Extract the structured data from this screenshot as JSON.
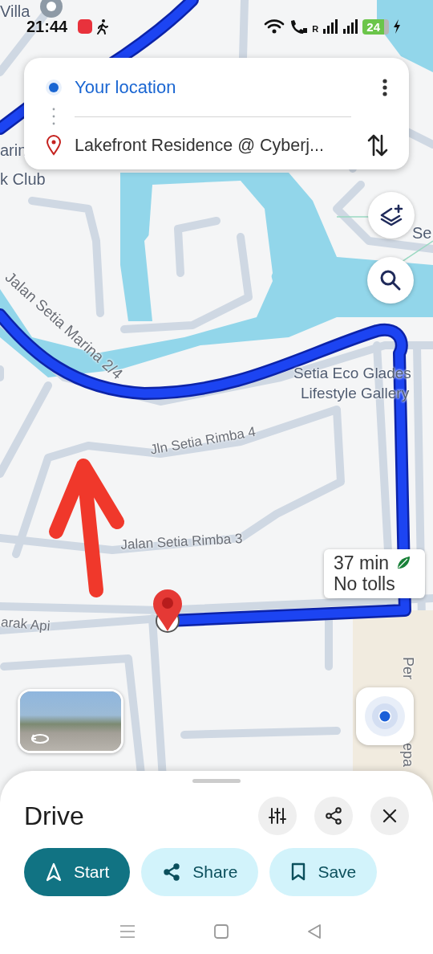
{
  "status_bar": {
    "time": "21:44",
    "roaming": "R",
    "battery": "24"
  },
  "directions": {
    "origin": "Your location",
    "destination": "Lakefront Residence @ Cyberj..."
  },
  "map": {
    "labels": [
      {
        "text": "Villa",
        "kind": "place"
      },
      {
        "text": "arin",
        "kind": "place"
      },
      {
        "text": "k Club",
        "kind": "place"
      },
      {
        "text": "Jalan Setia Marina 2/4",
        "kind": "road"
      },
      {
        "text": "Se",
        "kind": "place"
      },
      {
        "text": "Setia Eco Glades",
        "kind": "place"
      },
      {
        "text": "Lifestyle Gallery",
        "kind": "place"
      },
      {
        "text": "Jln Setia Rimba 4",
        "kind": "road"
      },
      {
        "text": "Jalan Setia Rimba 3",
        "kind": "road"
      },
      {
        "text": "arak Api",
        "kind": "road"
      },
      {
        "text": "Per",
        "kind": "road"
      },
      {
        "text": "epa",
        "kind": "road"
      }
    ],
    "route_info": {
      "duration": "37 min",
      "tolls": "No tolls"
    }
  },
  "sheet": {
    "title": "Drive",
    "actions": [
      {
        "label": "Start",
        "kind": "start"
      },
      {
        "label": "Share",
        "kind": "share"
      },
      {
        "label": "Save",
        "kind": "save"
      }
    ]
  }
}
